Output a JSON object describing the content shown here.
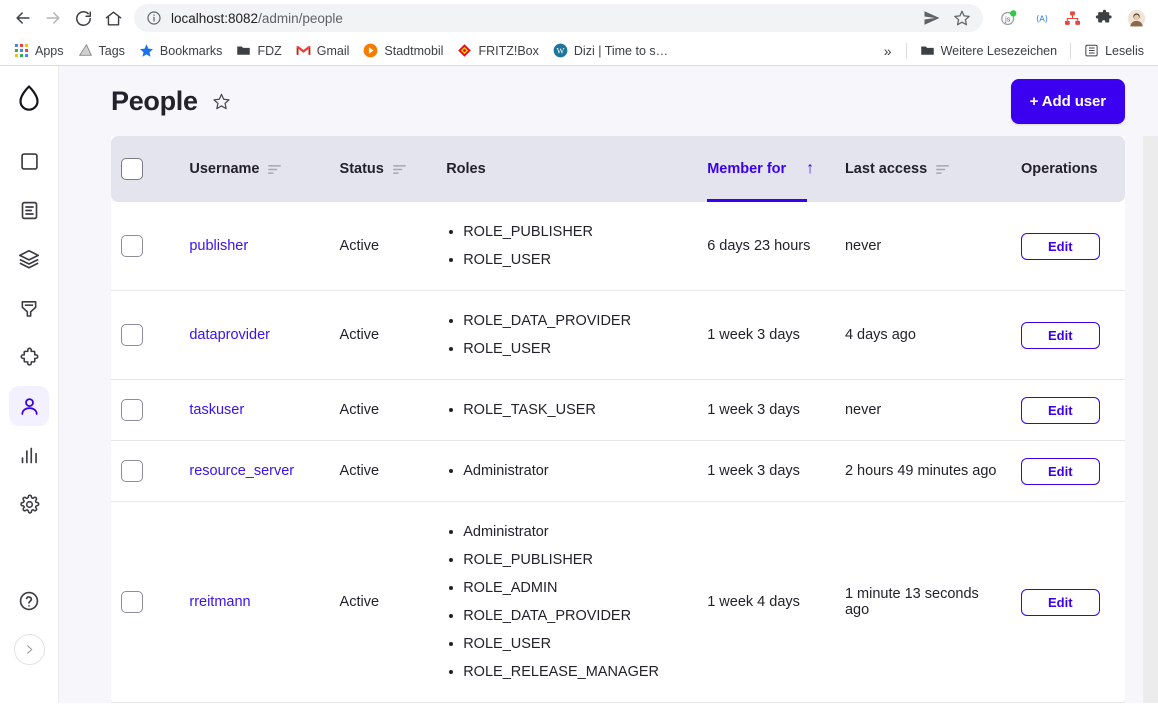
{
  "browser": {
    "nav": {
      "back_label": "Back",
      "forward_label": "Forward",
      "reload_label": "Reload",
      "home_label": "Home"
    },
    "omnibox": {
      "url_host": "localhost:8082",
      "url_path": "/admin/people",
      "info_icon": "info-circle-icon",
      "share_icon": "share-icon",
      "bookmark_icon": "star-outline-icon"
    },
    "extensions": [
      {
        "name": "js-extension-icon",
        "label": "JS"
      },
      {
        "name": "axe-extension-icon",
        "label": "(A)"
      },
      {
        "name": "sitemap-extension-icon",
        "label": ""
      },
      {
        "name": "puzzle-extensions-icon",
        "label": ""
      },
      {
        "name": "profile-avatar-icon",
        "label": ""
      }
    ],
    "bookmarks": [
      {
        "label": "Apps",
        "icon": "apps-grid-icon"
      },
      {
        "label": "Tags",
        "icon": "tags-icon"
      },
      {
        "label": "Bookmarks",
        "icon": "star-icon"
      },
      {
        "label": "FDZ",
        "icon": "folder-icon"
      },
      {
        "label": "Gmail",
        "icon": "gmail-icon"
      },
      {
        "label": "Stadtmobil",
        "icon": "play-circle-icon"
      },
      {
        "label": "FRITZ!Box",
        "icon": "fritzbox-icon"
      },
      {
        "label": "Dizi | Time to s…",
        "icon": "wordpress-icon"
      }
    ],
    "overflow_label": "»",
    "right_bookmarks": [
      {
        "label": "Weitere Lesezeichen",
        "icon": "folder-icon"
      },
      {
        "label": "Leselis",
        "icon": "reading-list-icon"
      }
    ]
  },
  "sidebar": {
    "logo_icon": "droplet-logo-icon",
    "items": [
      {
        "name": "content-icon",
        "label": "Content",
        "active": false
      },
      {
        "name": "document-icon",
        "label": "Structure",
        "active": false
      },
      {
        "name": "layers-icon",
        "label": "Appearance",
        "active": false
      },
      {
        "name": "extend-icon",
        "label": "Extend",
        "active": false
      },
      {
        "name": "puzzle-icon",
        "label": "Modules",
        "active": false
      },
      {
        "name": "person-icon",
        "label": "People",
        "active": true
      },
      {
        "name": "reports-icon",
        "label": "Reports",
        "active": false
      },
      {
        "name": "gear-icon",
        "label": "Configuration",
        "active": false
      }
    ],
    "help_icon": "help-circle-icon",
    "expand_icon": "chevron-right-icon"
  },
  "header": {
    "title": "People",
    "star_icon": "star-outline-icon",
    "add_user_label": "+ Add user"
  },
  "table": {
    "columns": [
      {
        "key": "checkbox",
        "label": "",
        "sortable": false,
        "sorted": false
      },
      {
        "key": "username",
        "label": "Username",
        "sortable": true,
        "sorted": false
      },
      {
        "key": "status",
        "label": "Status",
        "sortable": true,
        "sorted": false
      },
      {
        "key": "roles",
        "label": "Roles",
        "sortable": false,
        "sorted": false
      },
      {
        "key": "member_for",
        "label": "Member for",
        "sortable": true,
        "sorted": true,
        "sort_dir": "↑"
      },
      {
        "key": "last_access",
        "label": "Last access",
        "sortable": true,
        "sorted": false
      },
      {
        "key": "operations",
        "label": "Operations",
        "sortable": false,
        "sorted": false
      }
    ],
    "select_all_checkbox": false,
    "edit_label": "Edit",
    "rows": [
      {
        "username": "publisher",
        "status": "Active",
        "roles": [
          "ROLE_PUBLISHER",
          "ROLE_USER"
        ],
        "member_for": "6 days 23 hours",
        "last_access": "never"
      },
      {
        "username": "dataprovider",
        "status": "Active",
        "roles": [
          "ROLE_DATA_PROVIDER",
          "ROLE_USER"
        ],
        "member_for": "1 week 3 days",
        "last_access": "4 days ago"
      },
      {
        "username": "taskuser",
        "status": "Active",
        "roles": [
          "ROLE_TASK_USER"
        ],
        "member_for": "1 week 3 days",
        "last_access": "never"
      },
      {
        "username": "resource_server",
        "status": "Active",
        "roles": [
          "Administrator"
        ],
        "member_for": "1 week 3 days",
        "last_access": "2 hours 49 minutes ago"
      },
      {
        "username": "rreitmann",
        "status": "Active",
        "roles": [
          "Administrator",
          "ROLE_PUBLISHER",
          "ROLE_ADMIN",
          "ROLE_DATA_PROVIDER",
          "ROLE_USER",
          "ROLE_RELEASE_MANAGER"
        ],
        "member_for": "1 week 4 days",
        "last_access": "1 minute 13 seconds ago"
      }
    ]
  },
  "colors": {
    "accent": "#3b00f0",
    "link": "#3b11ef",
    "header_bg": "#e4e4ef",
    "page_bg": "#f7f7fb",
    "text": "#23222b"
  }
}
